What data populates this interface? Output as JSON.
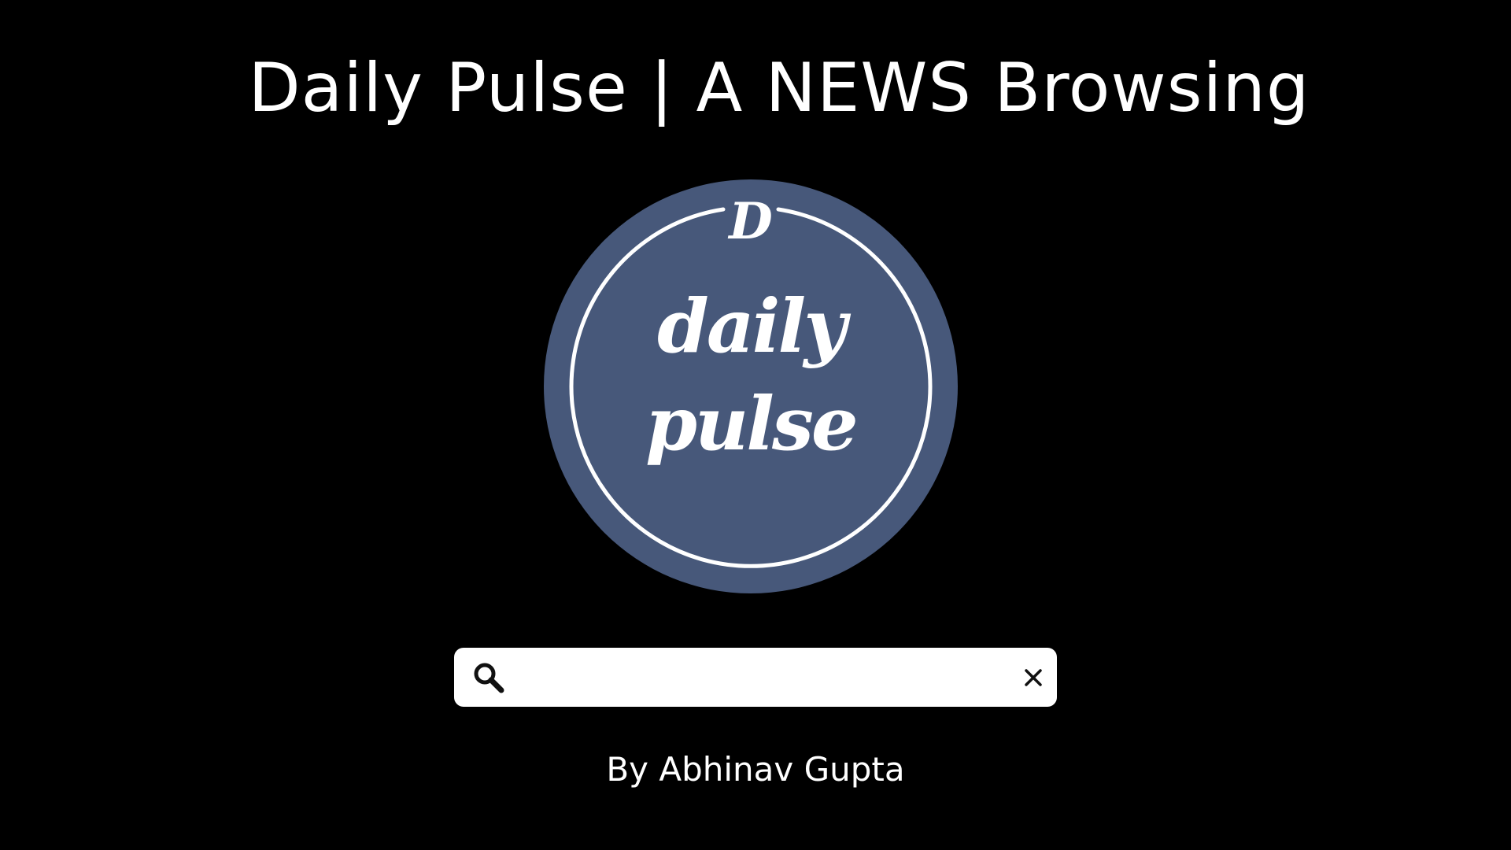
{
  "header": {
    "title": "Daily Pulse | A NEWS Browsing"
  },
  "logo": {
    "monogram": "D",
    "line1": "daily",
    "line2": "pulse",
    "background_color": "#47587a",
    "ring_color": "#ffffff"
  },
  "search": {
    "value": "",
    "placeholder": "",
    "leading_icon": "search-icon",
    "trailing_icon": "close-icon"
  },
  "footer": {
    "byline": "By Abhinav Gupta"
  },
  "colors": {
    "background": "#000000",
    "text": "#ffffff",
    "search_background": "#ffffff",
    "icon": "#111111"
  }
}
